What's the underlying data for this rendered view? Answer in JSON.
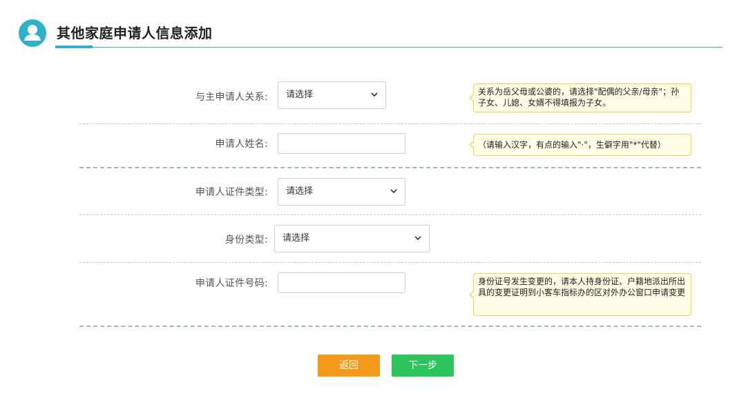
{
  "header": {
    "title": "其他家庭申请人信息添加",
    "icon": "user-avatar-icon",
    "accent_color": "#2db3c9"
  },
  "form": {
    "relation": {
      "label": "与主申请人关系:",
      "value": "请选择",
      "tip": "关系为岳父母或公婆的，请选择\"配偶的父亲/母亲\"；孙子女、儿媳、女婿不得填报为子女。"
    },
    "name": {
      "label": "申请人姓名:",
      "value": "",
      "tip": "（请输入汉字，有点的输入\"·\"，生僻字用\"*\"代替）"
    },
    "cert_type": {
      "label": "申请人证件类型:",
      "value": "请选择"
    },
    "identity_type": {
      "label": "身份类型:",
      "value": "请选择"
    },
    "cert_number": {
      "label": "申请人证件号码:",
      "value": "",
      "tip": "身份证号发生变更的，请本人持身份证、户籍地派出所出具的变更证明到小客车指标办的区对外办公窗口申请变更"
    }
  },
  "buttons": {
    "back": "返回",
    "next": "下一步"
  },
  "colors": {
    "back_button": "#f59a1a",
    "next_button": "#2cc45c",
    "tip_background": "#fffde6",
    "tip_border": "#f3d34a"
  }
}
